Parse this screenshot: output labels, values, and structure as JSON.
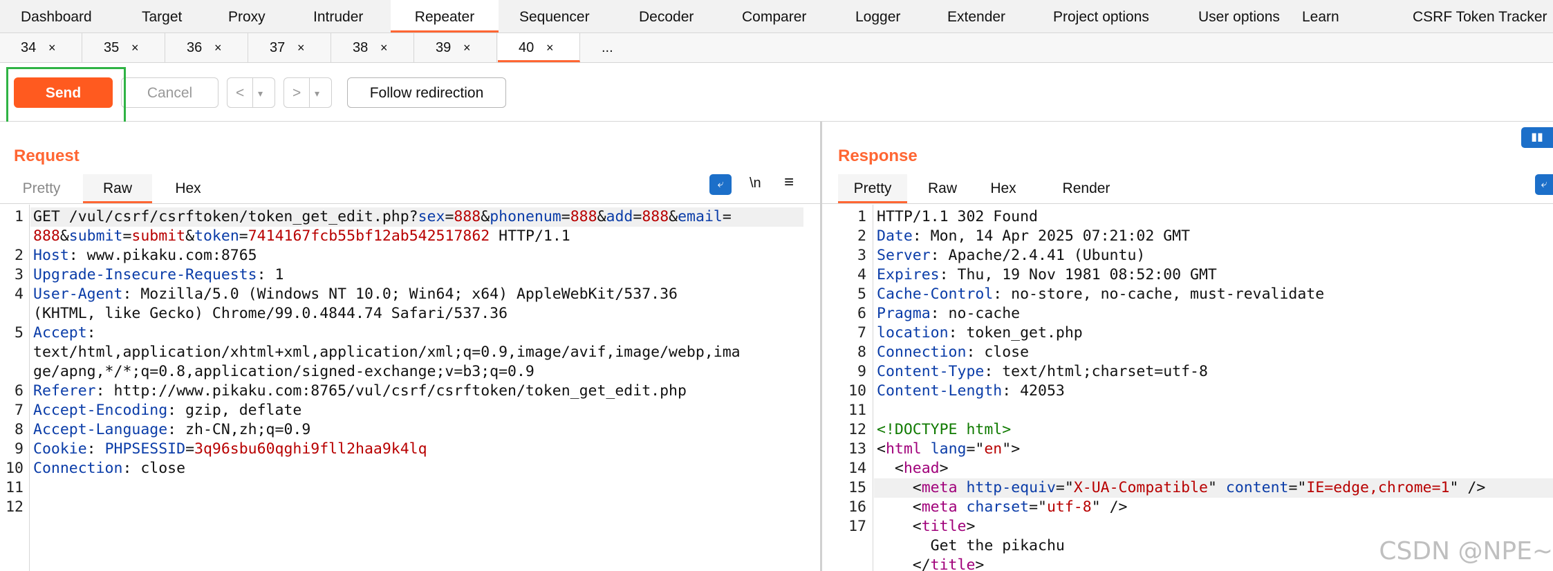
{
  "top_tabs": [
    "Dashboard",
    "Target",
    "Proxy",
    "Intruder",
    "Repeater",
    "Sequencer",
    "Decoder",
    "Comparer",
    "Logger",
    "Extender",
    "Project options",
    "User options",
    "Learn",
    "CSRF Token Tracker"
  ],
  "sub_tabs": [
    {
      "num": "34",
      "close": "×"
    },
    {
      "num": "35",
      "close": "×"
    },
    {
      "num": "36",
      "close": "×"
    },
    {
      "num": "37",
      "close": "×"
    },
    {
      "num": "38",
      "close": "×"
    },
    {
      "num": "39",
      "close": "×"
    },
    {
      "num": "40",
      "close": "×"
    }
  ],
  "sub_tabs_more": "...",
  "toolbar": {
    "send": "Send",
    "cancel": "Cancel",
    "back": "<",
    "back_menu": "▾",
    "forward": ">",
    "forward_menu": "▾",
    "follow": "Follow redirection"
  },
  "request": {
    "title": "Request",
    "tabs": [
      "Pretty",
      "Raw",
      "Hex"
    ],
    "icon_newline": "\\n",
    "icon_menu": "≡",
    "line_numbers": [
      "1",
      "",
      "2",
      "3",
      "4",
      "",
      "5",
      "",
      "",
      "6",
      "7",
      "8",
      "9",
      "10",
      "11",
      "12"
    ],
    "lines": [
      [
        {
          "c": "",
          "t": "GET /vul/csrf/csrftoken/token_get_edit.php?"
        },
        {
          "c": "k",
          "t": "sex"
        },
        {
          "c": "",
          "t": "="
        },
        {
          "c": "v",
          "t": "888"
        },
        {
          "c": "",
          "t": "&"
        },
        {
          "c": "k",
          "t": "phonenum"
        },
        {
          "c": "",
          "t": "="
        },
        {
          "c": "v",
          "t": "888"
        },
        {
          "c": "",
          "t": "&"
        },
        {
          "c": "k",
          "t": "add"
        },
        {
          "c": "",
          "t": "="
        },
        {
          "c": "v",
          "t": "888"
        },
        {
          "c": "",
          "t": "&"
        },
        {
          "c": "k",
          "t": "email"
        },
        {
          "c": "",
          "t": "="
        }
      ],
      [
        {
          "c": "v",
          "t": "888"
        },
        {
          "c": "",
          "t": "&"
        },
        {
          "c": "k",
          "t": "submit"
        },
        {
          "c": "",
          "t": "="
        },
        {
          "c": "v",
          "t": "submit"
        },
        {
          "c": "",
          "t": "&"
        },
        {
          "c": "k",
          "t": "token"
        },
        {
          "c": "",
          "t": "="
        },
        {
          "c": "v",
          "t": "7414167fcb55bf12ab542517862"
        },
        {
          "c": "",
          "t": " HTTP/1.1"
        }
      ],
      [
        {
          "c": "k",
          "t": "Host"
        },
        {
          "c": "",
          "t": ": www.pikaku.com:8765"
        }
      ],
      [
        {
          "c": "k",
          "t": "Upgrade-Insecure-Requests"
        },
        {
          "c": "",
          "t": ": 1"
        }
      ],
      [
        {
          "c": "k",
          "t": "User-Agent"
        },
        {
          "c": "",
          "t": ": Mozilla/5.0 (Windows NT 10.0; Win64; x64) AppleWebKit/537.36"
        }
      ],
      [
        {
          "c": "",
          "t": "(KHTML, like Gecko) Chrome/99.0.4844.74 Safari/537.36"
        }
      ],
      [
        {
          "c": "k",
          "t": "Accept"
        },
        {
          "c": "",
          "t": ":"
        }
      ],
      [
        {
          "c": "",
          "t": "text/html,application/xhtml+xml,application/xml;q=0.9,image/avif,image/webp,ima"
        }
      ],
      [
        {
          "c": "",
          "t": "ge/apng,*/*;q=0.8,application/signed-exchange;v=b3;q=0.9"
        }
      ],
      [
        {
          "c": "k",
          "t": "Referer"
        },
        {
          "c": "",
          "t": ": http://www.pikaku.com:8765/vul/csrf/csrftoken/token_get_edit.php"
        }
      ],
      [
        {
          "c": "k",
          "t": "Accept-Encoding"
        },
        {
          "c": "",
          "t": ": gzip, deflate"
        }
      ],
      [
        {
          "c": "k",
          "t": "Accept-Language"
        },
        {
          "c": "",
          "t": ": zh-CN,zh;q=0.9"
        }
      ],
      [
        {
          "c": "k",
          "t": "Cookie"
        },
        {
          "c": "",
          "t": ": "
        },
        {
          "c": "k",
          "t": "PHPSESSID"
        },
        {
          "c": "",
          "t": "="
        },
        {
          "c": "v",
          "t": "3q96sbu60qghi9fll2haa9k4lq"
        }
      ],
      [
        {
          "c": "k",
          "t": "Connection"
        },
        {
          "c": "",
          "t": ": close"
        }
      ],
      [],
      []
    ]
  },
  "response": {
    "title": "Response",
    "tabs": [
      "Pretty",
      "Raw",
      "Hex",
      "Render"
    ],
    "line_numbers": [
      "1",
      "2",
      "3",
      "4",
      "5",
      "6",
      "7",
      "8",
      "9",
      "10",
      "11",
      "12",
      "13",
      "14",
      "15",
      "16",
      "17",
      ""
    ],
    "lines": [
      [
        {
          "c": "",
          "t": "HTTP/1.1 302 Found"
        }
      ],
      [
        {
          "c": "k",
          "t": "Date"
        },
        {
          "c": "",
          "t": ": Mon, 14 Apr 2025 07:21:02 GMT"
        }
      ],
      [
        {
          "c": "k",
          "t": "Server"
        },
        {
          "c": "",
          "t": ": Apache/2.4.41 (Ubuntu)"
        }
      ],
      [
        {
          "c": "k",
          "t": "Expires"
        },
        {
          "c": "",
          "t": ": Thu, 19 Nov 1981 08:52:00 GMT"
        }
      ],
      [
        {
          "c": "k",
          "t": "Cache-Control"
        },
        {
          "c": "",
          "t": ": no-store, no-cache, must-revalidate"
        }
      ],
      [
        {
          "c": "k",
          "t": "Pragma"
        },
        {
          "c": "",
          "t": ": no-cache"
        }
      ],
      [
        {
          "c": "k",
          "t": "location"
        },
        {
          "c": "",
          "t": ": token_get.php"
        }
      ],
      [
        {
          "c": "k",
          "t": "Connection"
        },
        {
          "c": "",
          "t": ": close"
        }
      ],
      [
        {
          "c": "k",
          "t": "Content-Type"
        },
        {
          "c": "",
          "t": ": text/html;charset=utf-8"
        }
      ],
      [
        {
          "c": "k",
          "t": "Content-Length"
        },
        {
          "c": "",
          "t": ": 42053"
        }
      ],
      [],
      [
        {
          "c": "t",
          "t": "<!DOCTYPE html>"
        }
      ],
      [
        {
          "c": "",
          "t": "<"
        },
        {
          "c": "tag",
          "t": "html"
        },
        {
          "c": "",
          "t": " "
        },
        {
          "c": "k",
          "t": "lang"
        },
        {
          "c": "",
          "t": "=\""
        },
        {
          "c": "v",
          "t": "en"
        },
        {
          "c": "",
          "t": "\">"
        }
      ],
      [
        {
          "c": "",
          "t": "  <"
        },
        {
          "c": "tag",
          "t": "head"
        },
        {
          "c": "",
          "t": ">"
        }
      ],
      [
        {
          "c": "",
          "t": "    <"
        },
        {
          "c": "tag",
          "t": "meta"
        },
        {
          "c": "",
          "t": " "
        },
        {
          "c": "k",
          "t": "http-equiv"
        },
        {
          "c": "",
          "t": "=\""
        },
        {
          "c": "v",
          "t": "X-UA-Compatible"
        },
        {
          "c": "",
          "t": "\" "
        },
        {
          "c": "k",
          "t": "content"
        },
        {
          "c": "",
          "t": "=\""
        },
        {
          "c": "v",
          "t": "IE=edge,chrome=1"
        },
        {
          "c": "",
          "t": "\" />"
        }
      ],
      [
        {
          "c": "",
          "t": "    <"
        },
        {
          "c": "tag",
          "t": "meta"
        },
        {
          "c": "",
          "t": " "
        },
        {
          "c": "k",
          "t": "charset"
        },
        {
          "c": "",
          "t": "=\""
        },
        {
          "c": "v",
          "t": "utf-8"
        },
        {
          "c": "",
          "t": "\" />"
        }
      ],
      [
        {
          "c": "",
          "t": "    <"
        },
        {
          "c": "tag",
          "t": "title"
        },
        {
          "c": "",
          "t": ">"
        }
      ],
      [
        {
          "c": "",
          "t": "      Get the pikachu"
        }
      ],
      [
        {
          "c": "",
          "t": "    </"
        },
        {
          "c": "tag",
          "t": "title"
        },
        {
          "c": "",
          "t": ">"
        }
      ]
    ]
  },
  "watermark": "CSDN @NPE~"
}
